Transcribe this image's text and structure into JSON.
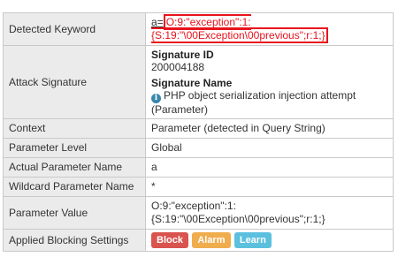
{
  "rows": {
    "detected_keyword": {
      "label": "Detected Keyword",
      "prefix": "a=",
      "value": "O:9:\"exception\":1:{S:19:\"\\00Exception\\00previous\";r:1;}"
    },
    "attack_signature": {
      "label": "Attack Signature",
      "id_heading": "Signature ID",
      "id_value": "200004188",
      "name_heading": "Signature Name",
      "name_value": "PHP object serialization injection attempt (Parameter)"
    },
    "context": {
      "label": "Context",
      "value": "Parameter (detected in Query String)"
    },
    "parameter_level": {
      "label": "Parameter Level",
      "value": "Global"
    },
    "actual_parameter_name": {
      "label": "Actual Parameter Name",
      "value": "a"
    },
    "wildcard_parameter_name": {
      "label": "Wildcard Parameter Name",
      "value": "*"
    },
    "parameter_value": {
      "label": "Parameter Value",
      "value": "O:9:\"exception\":1:{S:19:\"\\00Exception\\00previous\";r:1;}"
    },
    "applied_blocking_settings": {
      "label": "Applied Blocking Settings",
      "buttons": [
        "Block",
        "Alarm",
        "Learn"
      ]
    }
  },
  "colors": {
    "highlight": "#e8121b",
    "label_bg": "#ebebeb",
    "info_icon": "#3a87ad",
    "block": "#d9534f",
    "alarm": "#f0ad4e",
    "learn": "#5bc0de"
  },
  "icons": {
    "signature_name": "info-icon"
  }
}
